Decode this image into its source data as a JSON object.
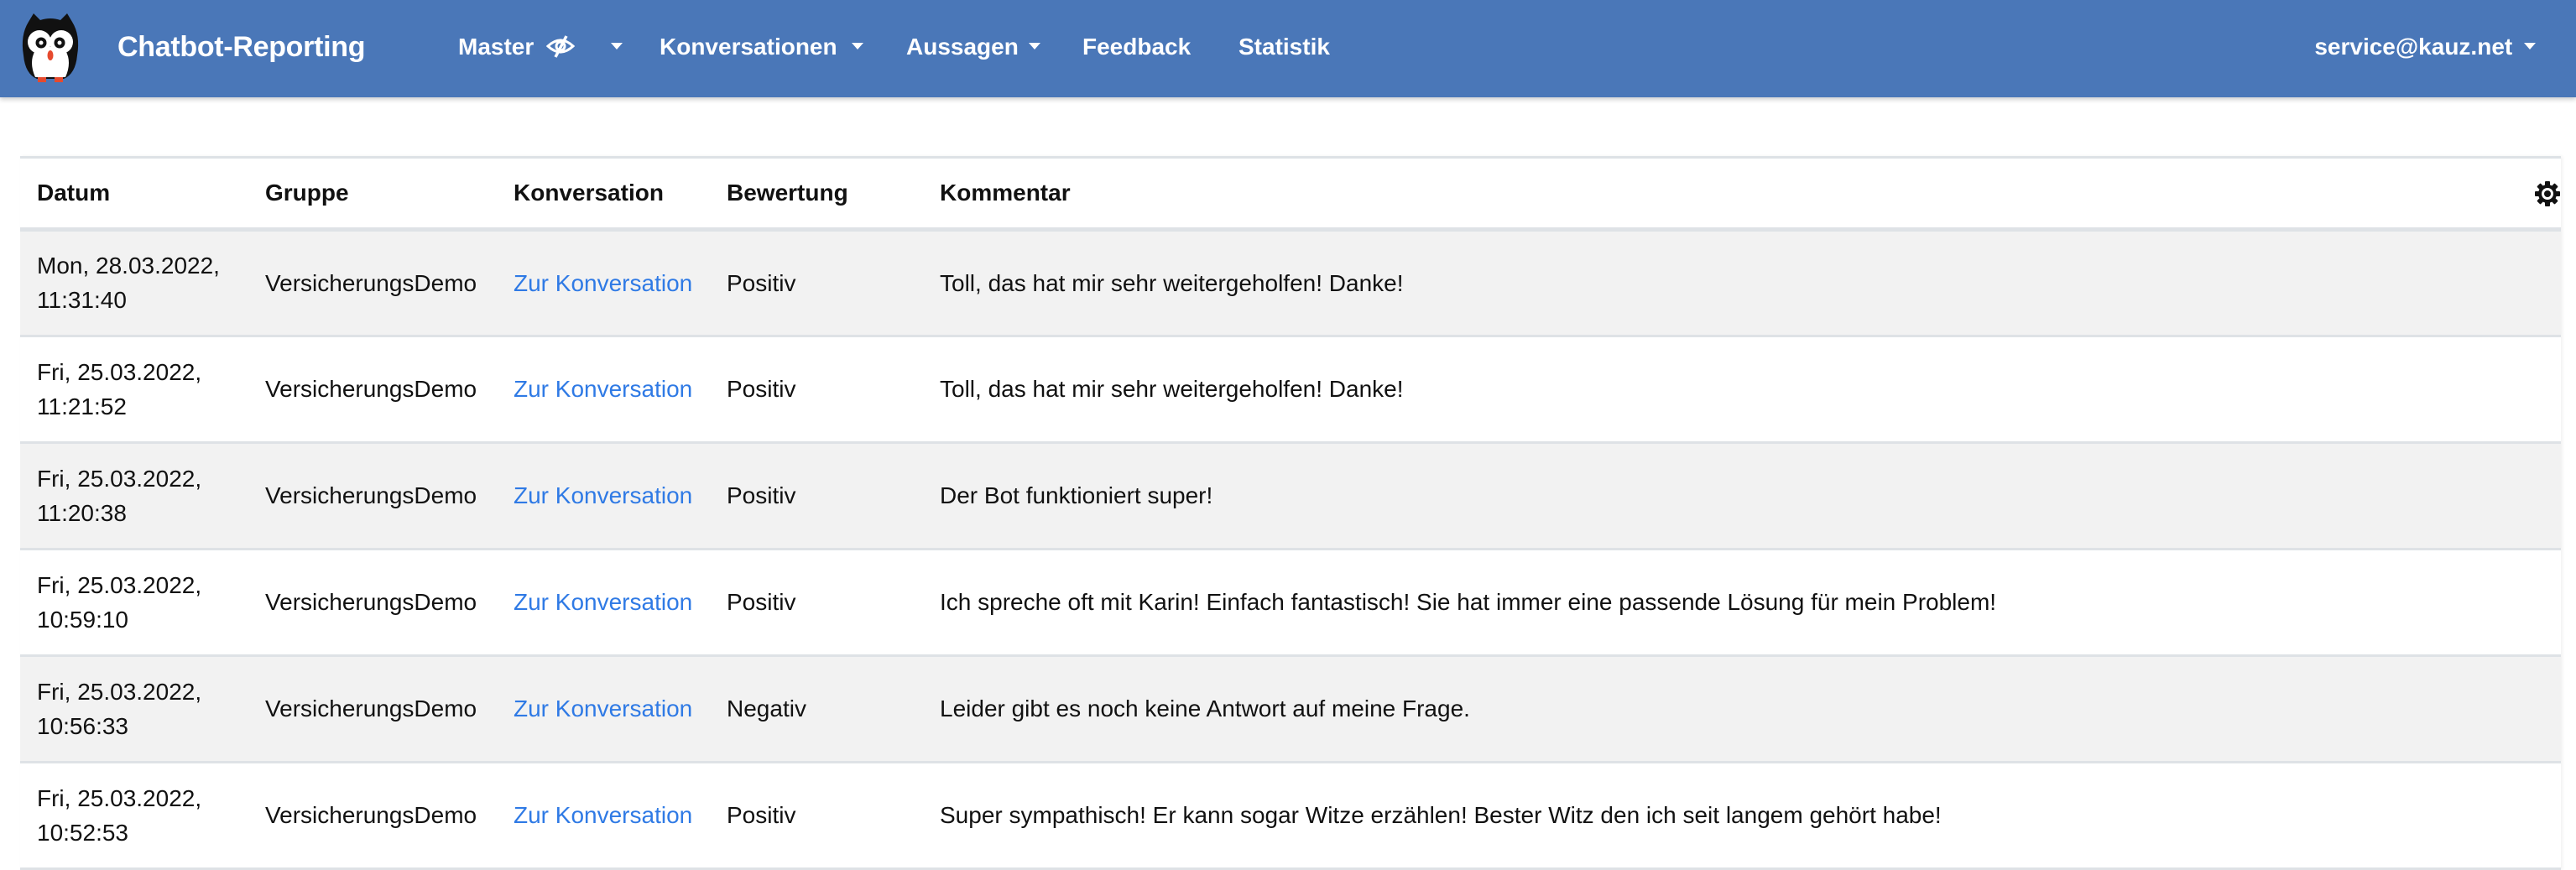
{
  "navbar": {
    "brand": "Chatbot-Reporting",
    "logo_icon": "owl-logo-icon",
    "items": [
      {
        "label": "Master",
        "icon": "eye-slash-icon",
        "has_dropdown": true
      },
      {
        "label": "Konversationen",
        "has_dropdown": true
      },
      {
        "label": "Aussagen",
        "has_dropdown": true
      },
      {
        "label": "Feedback",
        "has_dropdown": false
      },
      {
        "label": "Statistik",
        "has_dropdown": false
      }
    ],
    "user": {
      "label": "service@kauz.net",
      "has_dropdown": true
    },
    "color": "#4a77b8"
  },
  "table": {
    "columns": [
      "Datum",
      "Gruppe",
      "Konversation",
      "Bewertung",
      "Kommentar"
    ],
    "settings_icon": "gear-icon",
    "link_color": "#2f7ae5",
    "rows": [
      {
        "date": "Mon, 28.03.2022,",
        "time": "11:31:40",
        "group": "VersicherungsDemo",
        "link": "Zur Konversation",
        "rating": "Positiv",
        "comment": "Toll, das hat mir sehr weitergeholfen! Danke!"
      },
      {
        "date": "Fri, 25.03.2022,",
        "time": "11:21:52",
        "group": "VersicherungsDemo",
        "link": "Zur Konversation",
        "rating": "Positiv",
        "comment": "Toll, das hat mir sehr weitergeholfen! Danke!"
      },
      {
        "date": "Fri, 25.03.2022,",
        "time": "11:20:38",
        "group": "VersicherungsDemo",
        "link": "Zur Konversation",
        "rating": "Positiv",
        "comment": "Der Bot funktioniert super!"
      },
      {
        "date": "Fri, 25.03.2022,",
        "time": "10:59:10",
        "group": "VersicherungsDemo",
        "link": "Zur Konversation",
        "rating": "Positiv",
        "comment": "Ich spreche oft mit Karin! Einfach fantastisch! Sie hat immer eine passende Lösung für mein Problem!"
      },
      {
        "date": "Fri, 25.03.2022,",
        "time": "10:56:33",
        "group": "VersicherungsDemo",
        "link": "Zur Konversation",
        "rating": "Negativ",
        "comment": "Leider gibt es noch keine Antwort auf meine Frage."
      },
      {
        "date": "Fri, 25.03.2022,",
        "time": "10:52:53",
        "group": "VersicherungsDemo",
        "link": "Zur Konversation",
        "rating": "Positiv",
        "comment": "Super sympathisch! Er kann sogar Witze erzählen! Bester Witz den ich seit langem gehört habe!"
      }
    ]
  }
}
